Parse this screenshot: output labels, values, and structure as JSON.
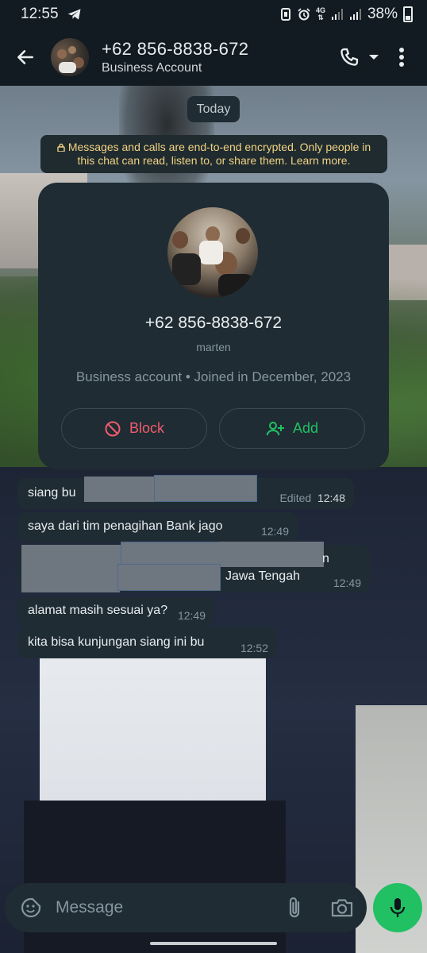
{
  "status_bar": {
    "time": "12:55",
    "network": "4G",
    "battery": "38%"
  },
  "header": {
    "title": "+62 856-8838-672",
    "subtitle": "Business Account"
  },
  "chat": {
    "date_chip": "Today",
    "encryption_notice": "Messages and calls are end-to-end encrypted. Only people in this chat can read, listen to, or share them. Learn more."
  },
  "contact_card": {
    "phone": "+62 856-8838-672",
    "name": "marten",
    "info": "Business account • Joined in December, 2023",
    "block_label": "Block",
    "add_label": "Add"
  },
  "messages": [
    {
      "text": "siang bu",
      "edited": "Edited",
      "time": "12:48"
    },
    {
      "text": "saya dari tim penagihan Bank jago",
      "time": "12:49"
    },
    {
      "text_line1_tail": "n",
      "text_line2_tail": "Jawa Tengah",
      "time": "12:49"
    },
    {
      "text": "alamat masih sesuai ya?",
      "time": "12:49"
    },
    {
      "text": "kita bisa kunjungan siang ini bu",
      "time": "12:52"
    }
  ],
  "input": {
    "placeholder": "Message"
  },
  "colors": {
    "accent_green": "#21c063",
    "block_red": "#f15c6d",
    "bubble": "#1f2c34",
    "header": "#111b21",
    "notice_yellow": "#f2d283"
  }
}
